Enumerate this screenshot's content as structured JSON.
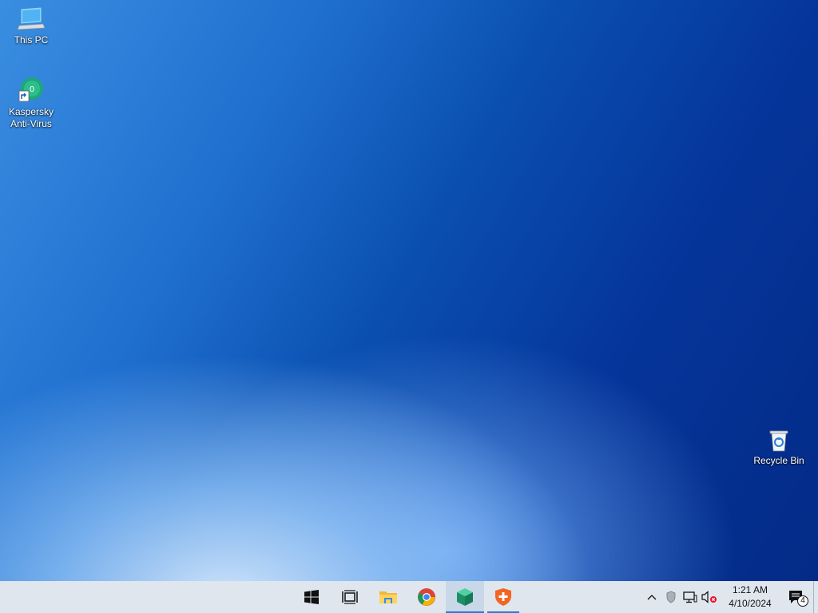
{
  "desktop": {
    "icons": [
      {
        "label": "This PC",
        "icon": "this-pc-icon"
      },
      {
        "label": "Kaspersky\nAnti-Virus",
        "icon": "kaspersky-icon"
      },
      {
        "label": "Recycle Bin",
        "icon": "recycle-bin-icon"
      }
    ]
  },
  "taskbar": {
    "buttons": [
      {
        "name": "start",
        "icon": "windows-logo-icon"
      },
      {
        "name": "task-view",
        "icon": "task-view-icon"
      },
      {
        "name": "file-explorer",
        "icon": "folder-icon"
      },
      {
        "name": "chrome",
        "icon": "chrome-icon"
      },
      {
        "name": "kaspersky",
        "icon": "kaspersky-cube-icon",
        "state": "active"
      },
      {
        "name": "security-app",
        "icon": "shield-plus-icon",
        "state": "running"
      }
    ],
    "tray": {
      "icons": [
        "chevron-up-icon",
        "security-shield-icon",
        "network-icon",
        "volume-muted-icon"
      ],
      "time": "1:21 AM",
      "date": "4/10/2024",
      "notification_count": "4"
    }
  },
  "colors": {
    "taskbar_bg": "#dfe6ee",
    "accent": "#2b7bd6",
    "kaspersky_green": "#1fa67a"
  }
}
